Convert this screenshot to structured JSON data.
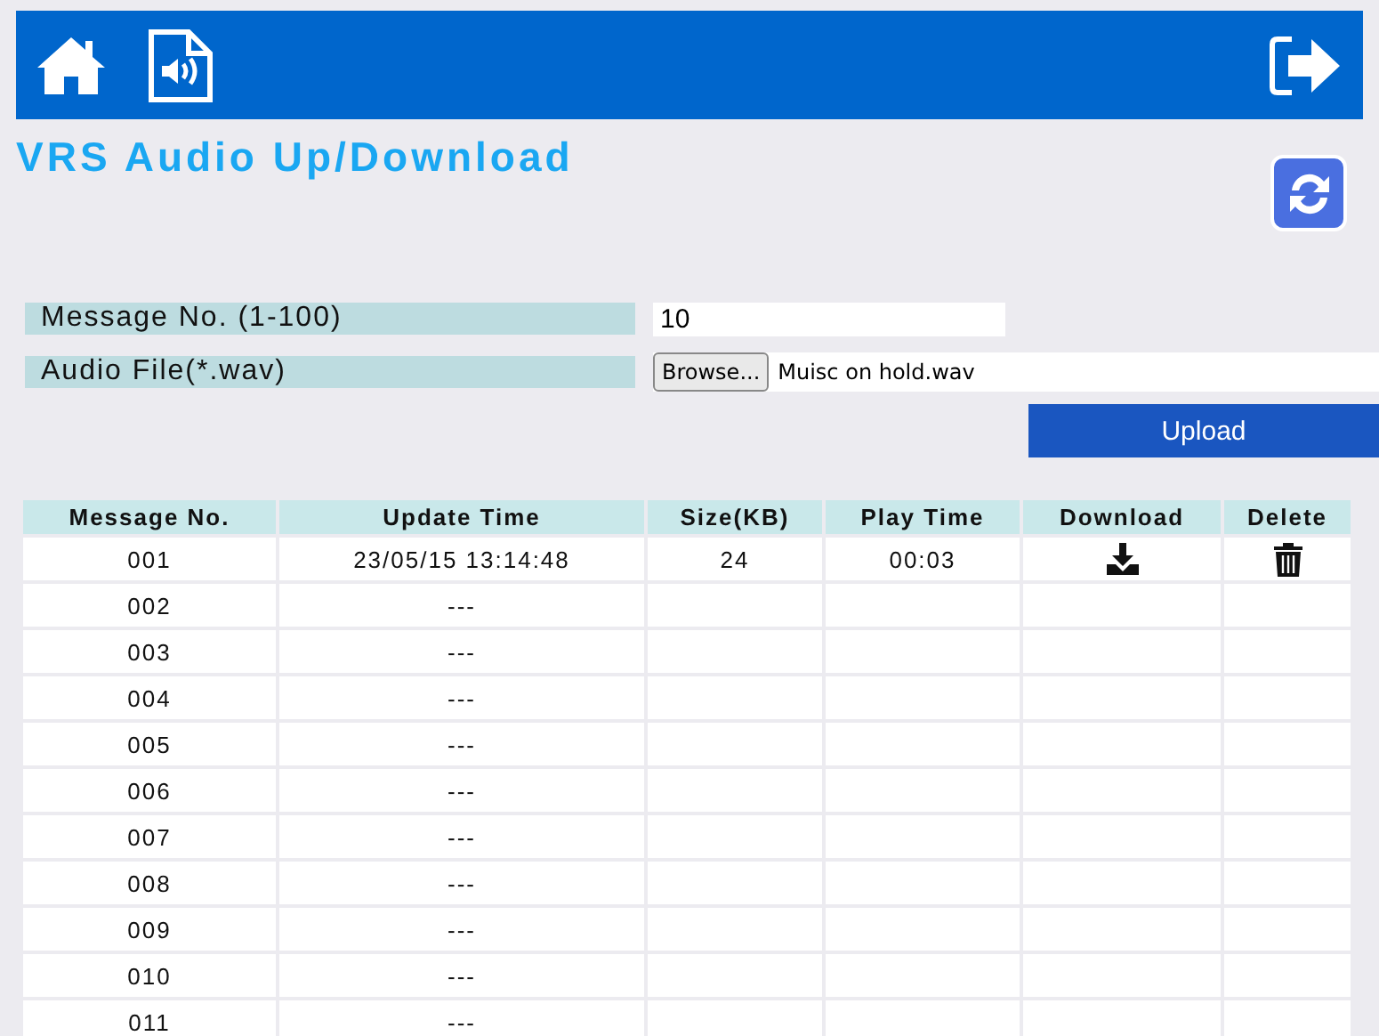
{
  "title": "VRS Audio Up/Download",
  "form": {
    "message_label": "Message No. (1-100)",
    "message_value": "10",
    "file_label": "Audio File(*.wav)",
    "browse_button": "Browse...",
    "file_name": "Muisc on hold.wav",
    "upload_button": "Upload"
  },
  "table": {
    "columns": [
      "Message No.",
      "Update Time",
      "Size(KB)",
      "Play Time",
      "Download",
      "Delete"
    ],
    "rows": [
      {
        "no": "001",
        "update_time": "23/05/15 13:14:48",
        "size": "24",
        "play_time": "00:03",
        "downloadable": true
      },
      {
        "no": "002",
        "update_time": "---",
        "downloadable": false
      },
      {
        "no": "003",
        "update_time": "---",
        "downloadable": false
      },
      {
        "no": "004",
        "update_time": "---",
        "downloadable": false
      },
      {
        "no": "005",
        "update_time": "---",
        "downloadable": false
      },
      {
        "no": "006",
        "update_time": "---",
        "downloadable": false
      },
      {
        "no": "007",
        "update_time": "---",
        "downloadable": false
      },
      {
        "no": "008",
        "update_time": "---",
        "downloadable": false
      },
      {
        "no": "009",
        "update_time": "---",
        "downloadable": false
      },
      {
        "no": "010",
        "update_time": "---",
        "downloadable": false
      },
      {
        "no": "011",
        "update_time": "---",
        "downloadable": false
      }
    ]
  }
}
